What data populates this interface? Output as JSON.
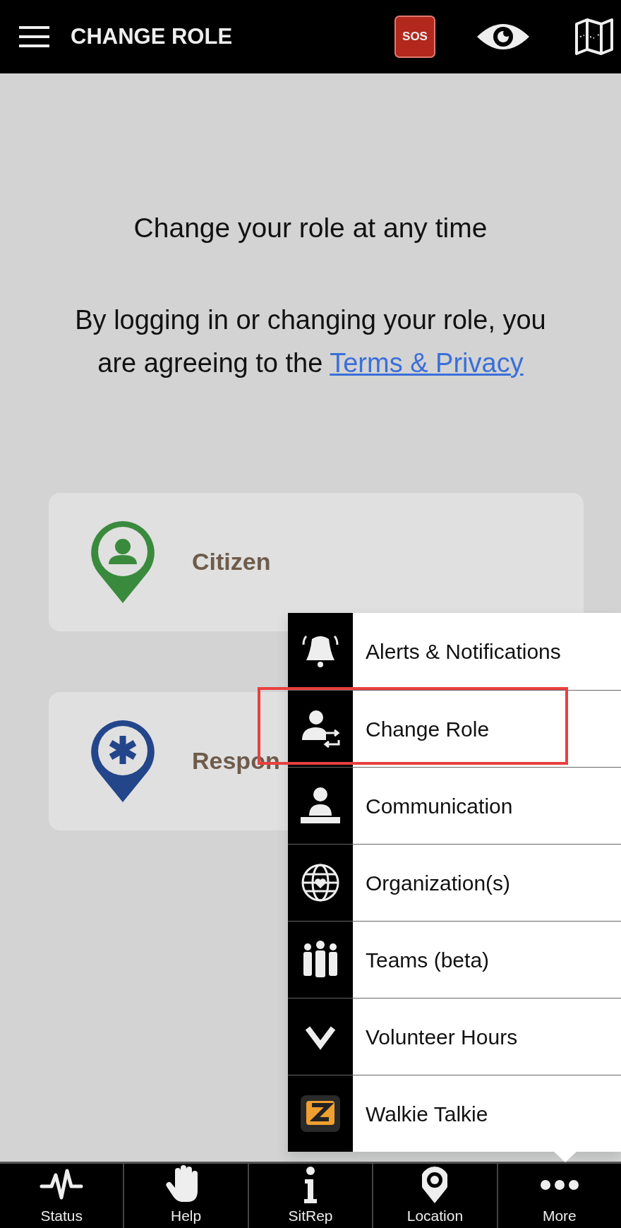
{
  "top_bar": {
    "title": "CHANGE ROLE",
    "sos_label": "SOS"
  },
  "intro": {
    "heading": "Change your role at any time",
    "agreement": "By logging in or changing your role, you are agreeing to the",
    "link": "Terms & Privacy"
  },
  "roles": [
    {
      "label": "Citizen",
      "kind": "citizen"
    },
    {
      "label": "Respon",
      "kind": "responder"
    }
  ],
  "more_menu": {
    "items": [
      {
        "label": "Alerts & Notifications",
        "kind": "bell",
        "highlighted": false
      },
      {
        "label": "Change Role",
        "kind": "swap",
        "highlighted": true
      },
      {
        "label": "Communication",
        "kind": "speaker",
        "highlighted": false
      },
      {
        "label": "Organization(s)",
        "kind": "globe",
        "highlighted": false
      },
      {
        "label": "Teams (beta)",
        "kind": "people",
        "highlighted": false
      },
      {
        "label": "Volunteer Hours",
        "kind": "chevron",
        "highlighted": false
      },
      {
        "label": "Walkie Talkie",
        "kind": "walkie",
        "highlighted": false
      }
    ]
  },
  "bottom_nav": [
    {
      "label": "Status",
      "kind": "pulse"
    },
    {
      "label": "Help",
      "kind": "hand"
    },
    {
      "label": "SitRep",
      "kind": "info"
    },
    {
      "label": "Location",
      "kind": "pin"
    },
    {
      "label": "More",
      "kind": "dots"
    }
  ]
}
